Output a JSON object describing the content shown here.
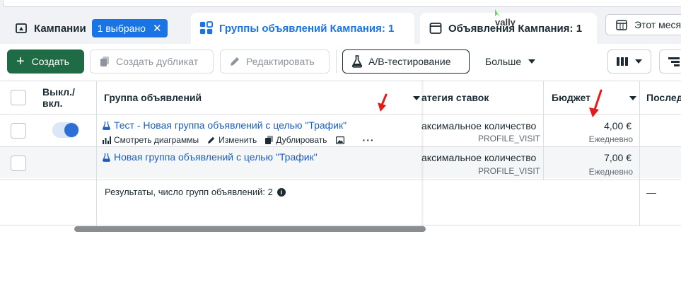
{
  "tabs": {
    "campaigns": {
      "label": "Кампании",
      "badge": "1 выбрано",
      "badge_close": "✕"
    },
    "adsets": {
      "label": "Группы объявлений Кампания: 1"
    },
    "ads": {
      "label": "Объявления Кампания: 1"
    },
    "date_range": {
      "label": "Этот месяц"
    }
  },
  "overlay_text": "vally",
  "toolbar": {
    "create": "Создать",
    "duplicate": "Создать дубликат",
    "edit": "Редактировать",
    "ab_test": "A/B-тестирование",
    "more": "Больше"
  },
  "table": {
    "headers": {
      "toggle": "Выкл./ вкл.",
      "adset": "Группа объявлений",
      "bid_strategy": "атегия ставок",
      "budget": "Бюджет",
      "last": "Послед"
    },
    "rows": [
      {
        "name": "Тест - Новая группа объявлений с целью \"Трафик\"",
        "toggle_on": true,
        "actions": [
          "Смотреть диаграммы",
          "Изменить",
          "Дублировать"
        ],
        "bid": "аксимальное количество",
        "bid_sub": "PROFILE_VISIT",
        "budget": "4,00 €",
        "budget_sub": "Ежедневно"
      },
      {
        "name": "Новая группа объявлений с целью \"Трафик\"",
        "toggle_on": false,
        "bid": "аксимальное количество",
        "bid_sub": "PROFILE_VISIT",
        "budget": "7,00 €",
        "budget_sub": "Ежедневно"
      }
    ],
    "results": "Результаты, число групп объявлений: 2",
    "results_last": "—"
  },
  "colors": {
    "accent_blue": "#1b74e4",
    "create_green": "#1e6b46",
    "annotation_red": "#e21b1b"
  }
}
